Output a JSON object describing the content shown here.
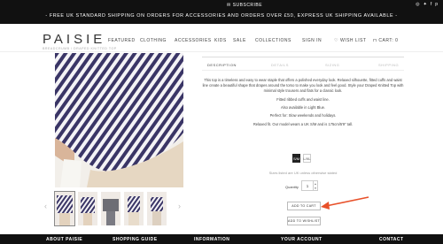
{
  "topbar": {
    "subscribe": "SUBSCRIBE",
    "promo": "- FREE UK STANDARD SHIPPING ON ORDERS FOR ACCESSORIES AND ORDERS OVER £50, EXPRESS UK SHIPPING AVAILABLE -",
    "social_icons": [
      "instagram-icon",
      "twitter-icon",
      "facebook-icon",
      "pinterest-icon"
    ]
  },
  "header": {
    "logo": "PAISIE",
    "breadcrumb": "BREADCRUMB / DRAPED KNITTED TOP",
    "nav": [
      "FEATURED",
      "CLOTHING",
      "ACCESSORIES",
      "KIDS",
      "SALE",
      "COLLECTIONS"
    ],
    "sign_in": "SIGN IN",
    "wishlist": "WISH LIST",
    "cart": "CART: 0"
  },
  "tabs": [
    "DESCRIPTION",
    "DETAILS",
    "SIZING",
    "SHIPPING"
  ],
  "description": [
    "This top is a timeless and easy to wear staple that offers a polished everyday look. Relaxed silhouette, fitted cuffs and waist line create a beautiful shape that drapes around the torso to make you look and feel good. Style your Draped Knitted Top with minimal style trousers and flats for a classic look.",
    "Fitted ribbed cuffs and waist line.",
    "Also available in Light Blue.",
    "Perfect for: Slow weekends and holidays.",
    "Relaxed fit. Our model wears a UK S/M and is 175cm/5'9\" tall."
  ],
  "sizes": [
    "S/M",
    "L/XL"
  ],
  "size_note": "Sizes listed are UK unless otherwise stated",
  "quantity": {
    "label": "Quantity",
    "value": "1"
  },
  "buttons": {
    "add_to_cart": "ADD TO CART",
    "add_to_wishlist": "ADD TO WISHLIST"
  },
  "footer": [
    "ABOUT PAISIE",
    "SHOPPING GUIDE",
    "INFORMATION",
    "YOUR ACCOUNT",
    "CONTACT"
  ],
  "colors": {
    "topbar": "#111111",
    "stripe": "#3a3566",
    "annotation": "#e8512a"
  }
}
